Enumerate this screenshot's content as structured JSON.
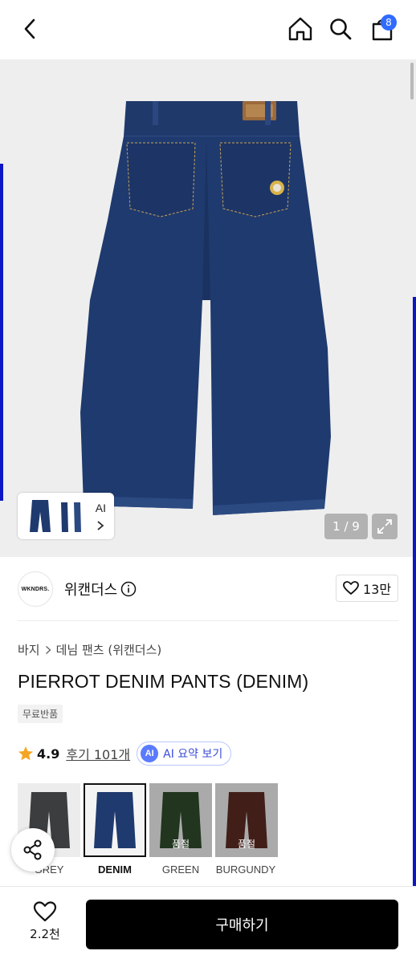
{
  "header": {
    "cart_count": "8"
  },
  "gallery": {
    "counter": "1 / 9",
    "ai_label": "AI"
  },
  "brand": {
    "logo_text": "WKNDRS.",
    "name": "위캔더스",
    "likes": "13만"
  },
  "product": {
    "breadcrumb": [
      "바지",
      "데님 팬츠 (위캔더스)"
    ],
    "title": "PIERROT DENIM PANTS (DENIM)",
    "tag": "무료반품",
    "rating": "4.9",
    "reviews_link": "후기 101개",
    "ai_badge": "AI",
    "ai_summary_label": "AI 요약 보기"
  },
  "colors": {
    "options": [
      {
        "label": "GREY",
        "selected": false,
        "sold_out_label": ""
      },
      {
        "label": "DENIM",
        "selected": true,
        "sold_out_label": ""
      },
      {
        "label": "GREEN",
        "selected": false,
        "sold_out_label": "품절"
      },
      {
        "label": "BURGUNDY",
        "selected": false,
        "sold_out_label": "품절"
      }
    ],
    "swatch_colors": [
      "#3b3d3f",
      "#1f3a6e",
      "#2f4a2c",
      "#5a2a22"
    ]
  },
  "bottom_bar": {
    "wishlist_count": "2.2천",
    "buy_label": "구매하기"
  },
  "theme": {
    "accent_blue": "#2f6bff",
    "denim": "#1f3a6e",
    "buy_button": "#000000"
  }
}
